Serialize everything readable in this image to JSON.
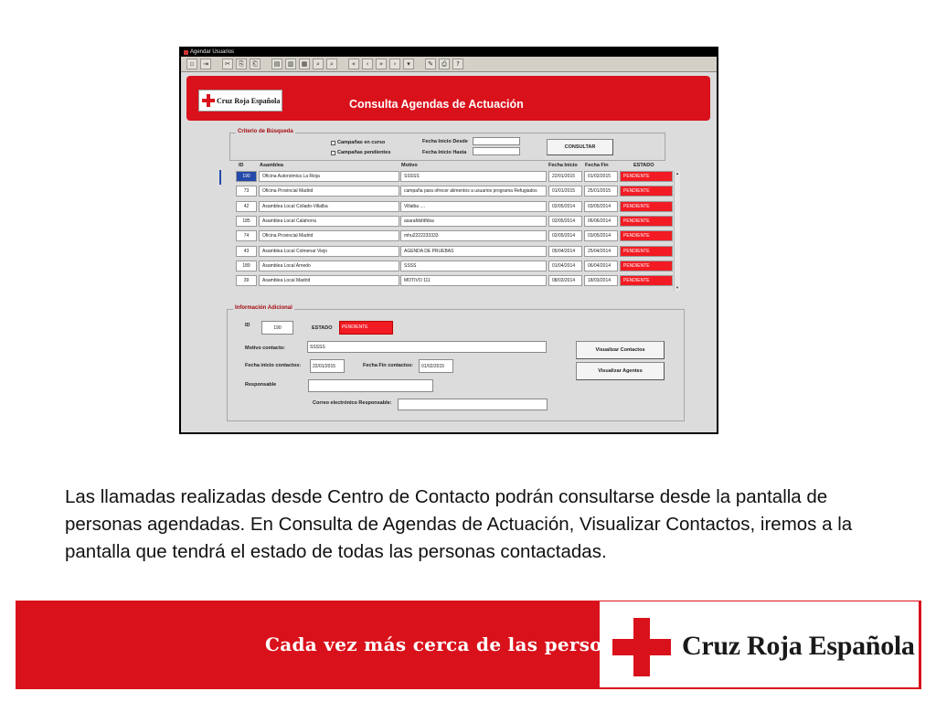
{
  "window": {
    "title": "Agendar Usuarios"
  },
  "toolbar": {
    "icons": [
      "save-icon",
      "exit-icon",
      "cut-icon",
      "copy-icon",
      "paste-icon",
      "insert-record-icon",
      "delete-record-icon",
      "clear-record-icon",
      "query-icon",
      "execute-query-icon",
      "first-record-icon",
      "previous-record-icon",
      "next-record-icon",
      "last-record-icon",
      "list-icon",
      "edit-icon",
      "print-icon",
      "help-icon"
    ],
    "glyphs": [
      "▫",
      "⇥",
      "✂",
      "⎘",
      "⎗",
      "▤",
      "▥",
      "▦",
      "⌕",
      "⌕",
      "«",
      "‹",
      "»",
      "›",
      "▾",
      "✎",
      "⎙",
      "?"
    ]
  },
  "header": {
    "logo_text": "Cruz Roja Española",
    "title": "Consulta Agendas de Actuación"
  },
  "search": {
    "legend": "Criterio de Búsqueda",
    "chk_active_label": "Campañas en curso",
    "chk_pending_label": "Campañas pendientes",
    "date_from_label": "Fecha Inicio Desde",
    "date_to_label": "Fecha Inicio Hasta",
    "date_from_value": "",
    "date_to_value": "",
    "consult_button": "CONSULTAR"
  },
  "table": {
    "columns": [
      "ID",
      "Asamblea",
      "Motivo",
      "Fecha Inicio",
      "Fecha Fin",
      "ESTADO"
    ],
    "rows": [
      {
        "id": "190",
        "asamblea": "Oficina Autonómica La Rioja",
        "motivo": "SSSSS",
        "inicio": "22/01/2015",
        "fin": "01/02/2015",
        "estado": "PENDIENTE"
      },
      {
        "id": "73",
        "asamblea": "Oficina Provincial Madrid",
        "motivo": "campaña para ofrecer alimentos a usuarios programa Refugiados",
        "inicio": "01/01/2015",
        "fin": "25/01/2015",
        "estado": "PENDIENTE"
      },
      {
        "id": "42",
        "asamblea": "Asamblea Local Collado-Villalba",
        "motivo": "Villalba ....",
        "inicio": "02/05/2014",
        "fin": "03/05/2014",
        "estado": "PENDIENTE"
      },
      {
        "id": "185",
        "asamblea": "Asamblea Local Calahorra",
        "motivo": "asarafdsfdfdsa",
        "inicio": "02/05/2014",
        "fin": "06/06/2014",
        "estado": "PENDIENTE"
      },
      {
        "id": "74",
        "asamblea": "Oficina Provincial Madrid",
        "motivo": "mhu2222233333",
        "inicio": "02/05/2014",
        "fin": "03/05/2014",
        "estado": "PENDIENTE"
      },
      {
        "id": "43",
        "asamblea": "Asamblea Local Colmenar Viejo",
        "motivo": "AGENDA DE PRUEBAS",
        "inicio": "05/04/2014",
        "fin": "25/04/2014",
        "estado": "PENDIENTE"
      },
      {
        "id": "189",
        "asamblea": "Asamblea Local Arnedo",
        "motivo": "SSSS",
        "inicio": "01/04/2014",
        "fin": "06/04/2014",
        "estado": "PENDIENTE"
      },
      {
        "id": "39",
        "asamblea": "Asamblea Local Madrid",
        "motivo": "MOTIVO 111",
        "inicio": "08/03/2014",
        "fin": "18/03/2014",
        "estado": "PENDIENTE"
      }
    ]
  },
  "info": {
    "legend": "Información Adicional",
    "id_label": "ID",
    "id_value": "190",
    "estado_label": "ESTADO",
    "estado_value": "PENDIENTE",
    "motivo_label": "Motivo contacto:",
    "motivo_value": "SSSSS",
    "fecha_inicio_label": "Fecha inicio contactos:",
    "fecha_inicio_value": "22/01/2015",
    "fecha_fin_label": "Fecha Fin contactos:",
    "fecha_fin_value": "01/02/2015",
    "responsable_label": "Responsable",
    "responsable_value": "",
    "correo_label": "Correo electrónico Responsable:",
    "correo_value": "",
    "btn_contactos": "Visualizar Contactos",
    "btn_agentes": "Visualizar Agentes"
  },
  "caption": "Las llamadas realizadas desde Centro de Contacto podrán consultarse desde la pantalla de personas agendadas. En Consulta de Agendas de Actuación, Visualizar  Contactos, iremos a la pantalla que  tendrá el estado de todas las personas contactadas.",
  "banner": {
    "slogan": "Cada vez más cerca de las personas",
    "brand": "Cruz Roja Española"
  },
  "colors": {
    "red": "#d9111b",
    "status_red": "#f21b23",
    "selection": "#2449a8"
  }
}
